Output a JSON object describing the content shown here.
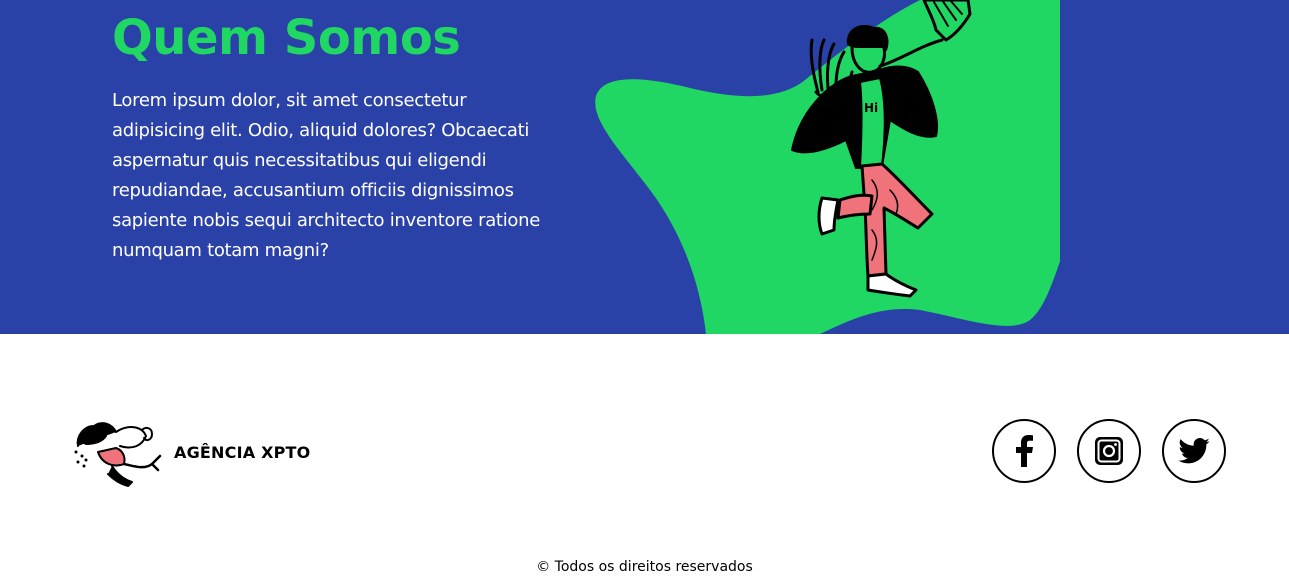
{
  "about": {
    "title": "Quem Somos",
    "text": "Lorem ipsum dolor, sit amet consectetur adipisicing elit. Odio, aliquid dolores? Obcaecati aspernatur quis necessitatibus qui eligendi repudiandae, accusantium officiis dignissimos sapiente nobis sequi architecto inventore ratione numquam totam magni?",
    "illustration_shirt_text": "Hi"
  },
  "footer": {
    "brand_name": "AGÊNCIA XPTO",
    "social": [
      {
        "name": "facebook",
        "icon": "facebook-icon"
      },
      {
        "name": "instagram",
        "icon": "instagram-icon"
      },
      {
        "name": "twitter",
        "icon": "twitter-icon"
      }
    ],
    "copyright": "© Todos os direitos reservados"
  },
  "colors": {
    "hero_background": "#2a41a7",
    "accent_green": "#20d764",
    "pants_pink": "#f0727a",
    "text_white": "#ffffff"
  }
}
